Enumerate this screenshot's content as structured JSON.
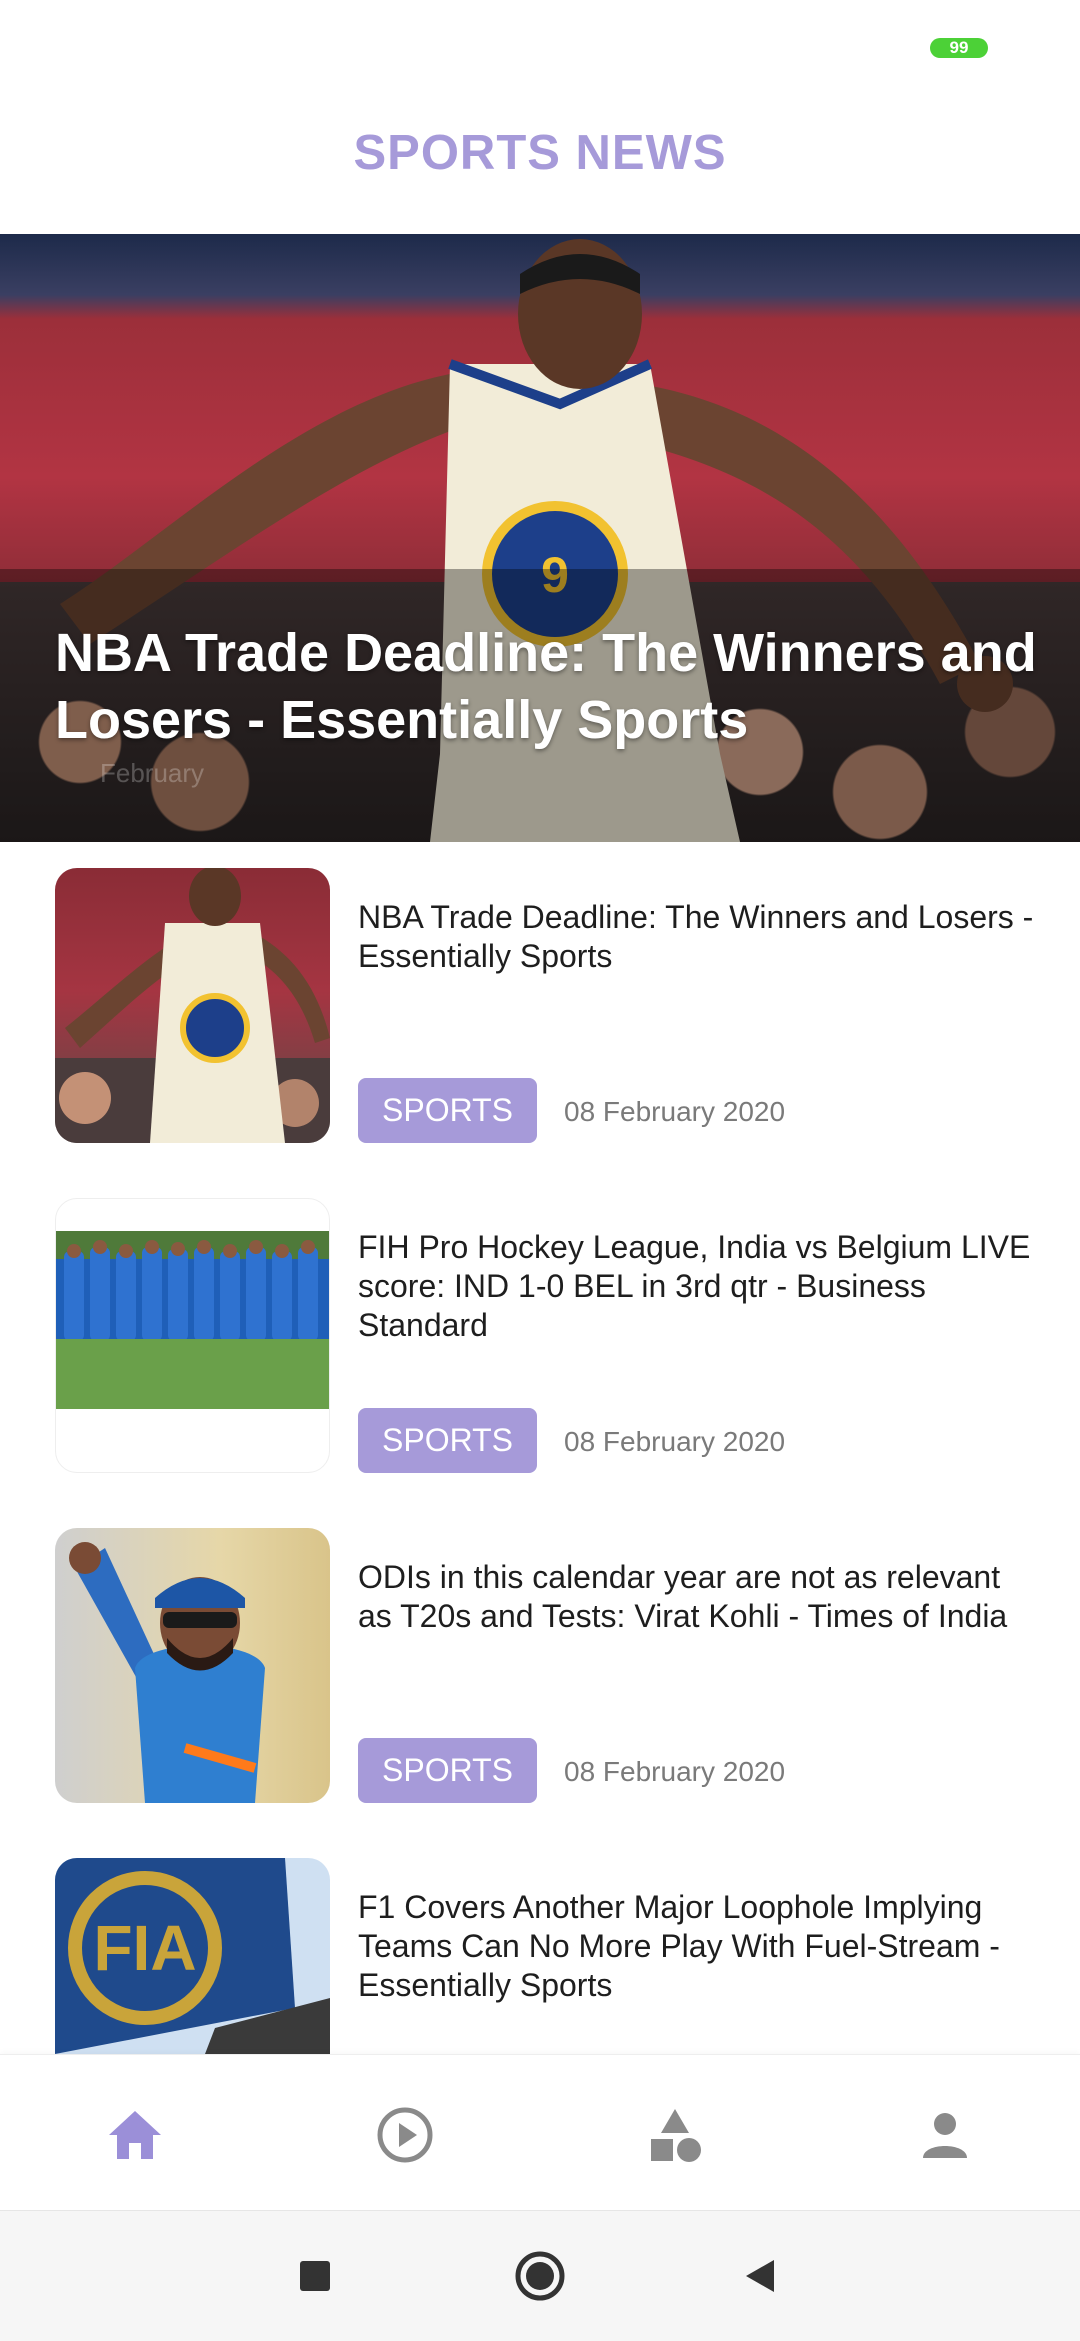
{
  "status_bar": {
    "battery": "99"
  },
  "header": {
    "title": "SPORTS NEWS"
  },
  "hero": {
    "title": "NBA Trade Deadline: The Winners and Losers - Essentially Sports",
    "date": "February"
  },
  "articles": [
    {
      "title": "NBA Trade Deadline: The Winners and Losers - Essentially Sports",
      "category": "SPORTS",
      "date": "08 February 2020",
      "image": "basketball-player-photo"
    },
    {
      "title": "FIH Pro Hockey League, India vs Belgium LIVE score: IND 1-0 BEL in 3rd qtr - Business Standard",
      "category": "SPORTS",
      "date": "08 February 2020",
      "image": "hockey-team-photo"
    },
    {
      "title": "ODIs in this calendar year are not as relevant as T20s and Tests: Virat Kohli - Times of India",
      "category": "SPORTS",
      "date": "08 February 2020",
      "image": "cricket-player-photo"
    },
    {
      "title": "F1 Covers Another Major Loophole Implying Teams Can No More Play With Fuel-Stream - Essentially Sports",
      "category": "",
      "date": "",
      "image": "fia-flag-photo"
    }
  ],
  "bottom_nav": {
    "items": [
      {
        "name": "home",
        "icon": "home-icon",
        "active": true
      },
      {
        "name": "videos",
        "icon": "play-circle-icon",
        "active": false
      },
      {
        "name": "categories",
        "icon": "shapes-icon",
        "active": false
      },
      {
        "name": "profile",
        "icon": "person-icon",
        "active": false
      }
    ],
    "active_color": "#9b8fd8",
    "inactive_color": "#8a8a8a"
  },
  "colors": {
    "accent": "#a69ad9"
  }
}
